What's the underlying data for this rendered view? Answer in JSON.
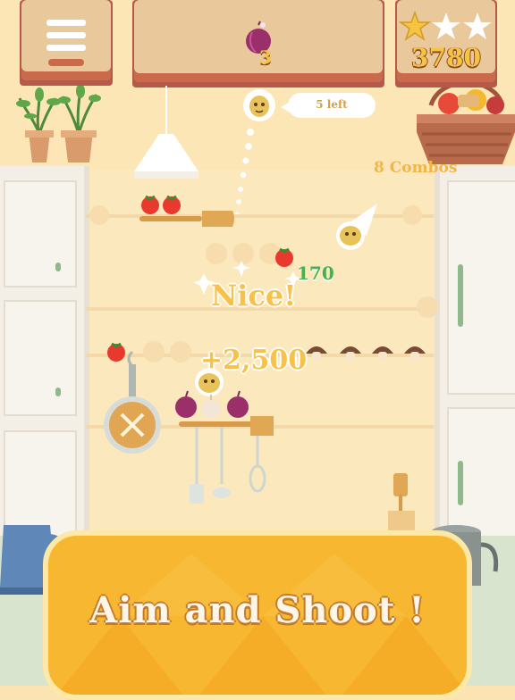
{
  "hud": {
    "menu_icon": "hamburger-menu-icon",
    "target_icon": "red-onion-icon",
    "target_count": "3",
    "stars_earned": 1,
    "stars_total": 3,
    "score": "3780",
    "shots_left": "5 left"
  },
  "play": {
    "combo_text": "8 Combos",
    "nice_text": "Nice!",
    "points_small": "170",
    "points_big": "+2,500"
  },
  "banner": {
    "text": "Aim and Shoot !"
  },
  "colors": {
    "banner": "#f7b731",
    "score": "#f5c542",
    "points_small": "#49b04a",
    "combo": "#f3b548"
  }
}
